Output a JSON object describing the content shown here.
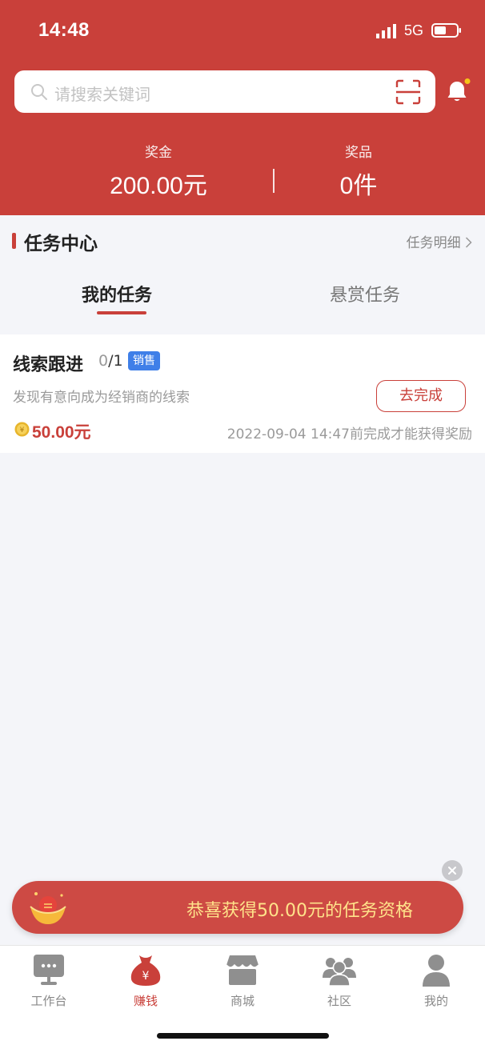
{
  "status_bar": {
    "time": "14:48",
    "network": "5G"
  },
  "search": {
    "placeholder": "请搜索关键词"
  },
  "stats": {
    "bonus_label": "奖金",
    "bonus_value": "200.00元",
    "prize_label": "奖品",
    "prize_value": "0件"
  },
  "section": {
    "title": "任务中心",
    "link": "任务明细"
  },
  "tabs": [
    {
      "label": "我的任务",
      "active": true
    },
    {
      "label": "悬赏任务",
      "active": false
    }
  ],
  "task": {
    "title": "线索跟进",
    "progress_current": "0",
    "progress_total": "/1",
    "tag": "销售",
    "description": "发现有意向成为经销商的线索",
    "button": "去完成",
    "reward": "50.00元",
    "deadline": "2022-09-04 14:47前完成才能获得奖励"
  },
  "toast": {
    "text": "恭喜获得50.00元的任务资格"
  },
  "nav": [
    {
      "label": "工作台",
      "icon": "workbench-icon",
      "active": false
    },
    {
      "label": "赚钱",
      "icon": "money-bag-icon",
      "active": true
    },
    {
      "label": "商城",
      "icon": "store-icon",
      "active": false
    },
    {
      "label": "社区",
      "icon": "community-icon",
      "active": false
    },
    {
      "label": "我的",
      "icon": "profile-icon",
      "active": false
    }
  ],
  "colors": {
    "brand": "#c9403a",
    "tag": "#3f7fe8",
    "toast_text": "#ffe38a"
  }
}
